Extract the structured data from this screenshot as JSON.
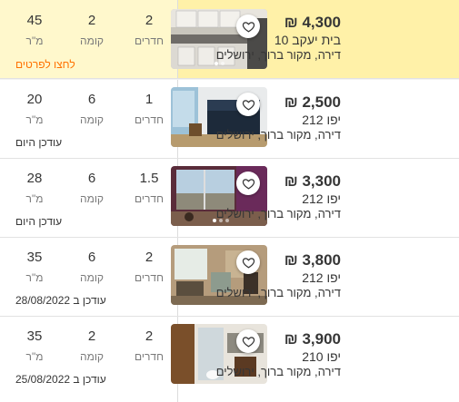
{
  "listings": [
    {
      "price": "₪ 4,300",
      "street": "בית יעקב 10",
      "address": "דירה, מקור ברוך, ירושלים",
      "rooms": "2",
      "floor": "2",
      "size": "45",
      "rooms_label": "חדרים",
      "floor_label": "קומה",
      "size_label": "מ\"ר",
      "footer": "לחצו לפרטים",
      "highlighted": true
    },
    {
      "price": "₪ 2,500",
      "street": "יפו 212",
      "address": "דירה, מקור ברוך, ירושלים",
      "rooms": "1",
      "floor": "6",
      "size": "20",
      "rooms_label": "חדרים",
      "floor_label": "קומה",
      "size_label": "מ\"ר",
      "footer": "עודכן היום",
      "highlighted": false
    },
    {
      "price": "₪ 3,300",
      "street": "יפו 212",
      "address": "דירה, מקור ברוך, ירושלים",
      "rooms": "1.5",
      "floor": "6",
      "size": "28",
      "rooms_label": "חדרים",
      "floor_label": "קומה",
      "size_label": "מ\"ר",
      "footer": "עודכן היום",
      "highlighted": false
    },
    {
      "price": "₪ 3,800",
      "street": "יפו 212",
      "address": "דירה, מקור ברוך, ירושלים",
      "rooms": "2",
      "floor": "6",
      "size": "35",
      "rooms_label": "חדרים",
      "floor_label": "קומה",
      "size_label": "מ\"ר",
      "footer": "עודכן ב 28/08/2022",
      "highlighted": false
    },
    {
      "price": "₪ 3,900",
      "street": "יפו 210",
      "address": "דירה, מקור ברוך, ירושלים",
      "rooms": "2",
      "floor": "2",
      "size": "35",
      "rooms_label": "חדרים",
      "floor_label": "קומה",
      "size_label": "מ\"ר",
      "footer": "עודכן ב 25/08/2022",
      "highlighted": false
    }
  ],
  "colors": {
    "highlight": "#fff1a8",
    "accent": "#ff7100"
  },
  "icons": {
    "favorite": "heart-outline-icon"
  }
}
